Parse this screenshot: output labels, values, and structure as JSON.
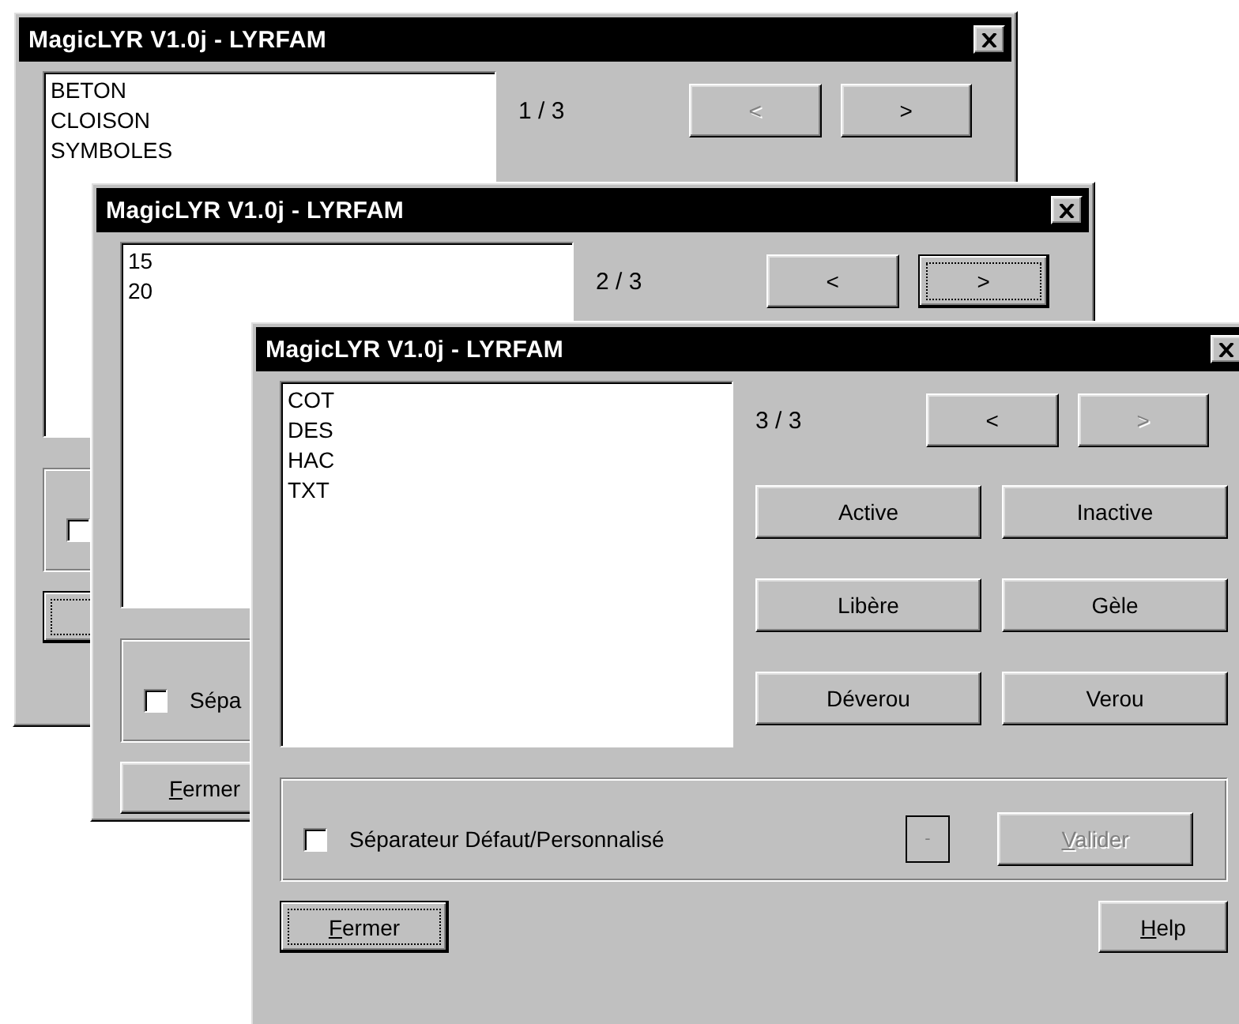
{
  "windows": [
    {
      "title": "MagicLYR V1.0j - LYRFAM",
      "list_items": [
        "BETON",
        "CLOISON",
        "SYMBOLES"
      ],
      "page": "1 / 3",
      "nav": [
        {
          "label": "<",
          "disabled": true,
          "focused": false
        },
        {
          "label": ">",
          "disabled": false,
          "focused": false
        }
      ],
      "separator": {
        "checked": false
      },
      "close_button": {
        "focused": true
      }
    },
    {
      "title": "MagicLYR V1.0j - LYRFAM",
      "list_items": [
        "15",
        "20"
      ],
      "page": "2 / 3",
      "nav": [
        {
          "label": "<",
          "disabled": false,
          "focused": false
        },
        {
          "label": ">",
          "disabled": false,
          "focused": true
        }
      ],
      "separator": {
        "label": "Sépa",
        "checked": false
      },
      "close_button": {
        "label": "Fermer",
        "focused": false
      }
    },
    {
      "title": "MagicLYR V1.0j - LYRFAM",
      "list_items": [
        "COT",
        "DES",
        "HAC",
        "TXT"
      ],
      "page": "3 / 3",
      "nav": [
        {
          "label": "<",
          "disabled": false,
          "focused": false
        },
        {
          "label": ">",
          "disabled": true,
          "focused": false
        }
      ],
      "actions": [
        {
          "label": "Active"
        },
        {
          "label": "Inactive"
        },
        {
          "label": "Libère"
        },
        {
          "label": "Gèle"
        },
        {
          "label": "Déverou"
        },
        {
          "label": "Verou"
        }
      ],
      "separator": {
        "label": "Séparateur Défaut/Personnalisé",
        "checked": false
      },
      "field": {
        "value": "-",
        "disabled": true
      },
      "validate": {
        "label": "Valider",
        "disabled": true
      },
      "close_button": {
        "label": "Fermer",
        "focused": true
      },
      "help": {
        "label": "Help"
      }
    }
  ]
}
